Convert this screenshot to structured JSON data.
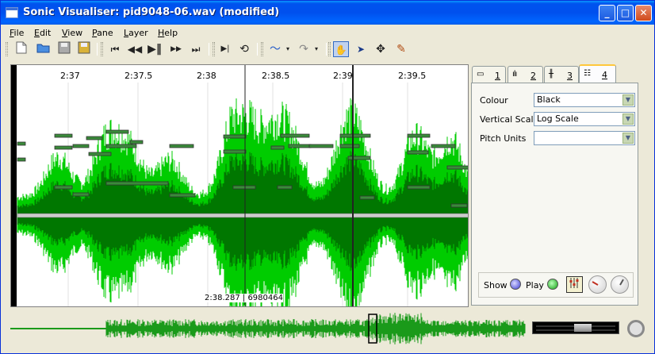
{
  "window": {
    "title": "Sonic Visualiser: pid9048-06.wav (modified)",
    "minimize": "_",
    "maximize": "□",
    "close": "✕"
  },
  "menu": {
    "items": [
      {
        "label": "File",
        "accel": "F",
        "rest": "ile"
      },
      {
        "label": "Edit",
        "accel": "E",
        "rest": "dit"
      },
      {
        "label": "View",
        "accel": "V",
        "rest": "iew"
      },
      {
        "label": "Pane",
        "accel": "P",
        "rest": "ane"
      },
      {
        "label": "Layer",
        "accel": "L",
        "rest": "ayer"
      },
      {
        "label": "Help",
        "accel": "H",
        "rest": "elp"
      }
    ]
  },
  "toolbar": {
    "icons": [
      "new-file-icon",
      "open-folder-icon",
      "save-icon",
      "save-session-icon",
      "rewind-start-icon",
      "rewind-icon",
      "play-pause-icon",
      "fast-forward-icon",
      "forward-end-icon",
      "play-selection-icon",
      "loop-icon",
      "solo-icon",
      "follow-playback-icon",
      "navigate-tool-icon",
      "select-tool-icon",
      "move-tool-icon",
      "draw-tool-icon"
    ],
    "glyphs": {
      "rewind_start": "⏮",
      "rewind": "◀◀",
      "play_pause": "▶‖",
      "ffwd": "▶▶",
      "end": "⏭",
      "play_sel": "▶|",
      "loop": "⟲",
      "solo": "〜",
      "follow": "↷",
      "navigate": "✋",
      "select": "➤",
      "move": "✥",
      "draw": "✎"
    }
  },
  "pane": {
    "time_ticks": [
      "2:37",
      "2:37.5",
      "2:38",
      "2:38.5",
      "2:39",
      "2:39.5"
    ],
    "cursor_readout": "2:38.287 | 6980464",
    "colors": {
      "waveform": "#00cc00",
      "waveform_dark": "#007700",
      "notes": "#333333",
      "note_fill": "#3a8a3a"
    }
  },
  "properties": {
    "tabs": [
      {
        "num": "1",
        "icon": "waveform-layer-icon",
        "glyph": "▭"
      },
      {
        "num": "2",
        "icon": "spectrum-layer-icon",
        "glyph": "ılı"
      },
      {
        "num": "3",
        "icon": "waveform-small-icon",
        "glyph": "╫"
      },
      {
        "num": "4",
        "icon": "notes-layer-icon",
        "glyph": "☷"
      }
    ],
    "selected_tab": "4",
    "fields": [
      {
        "label": "Colour",
        "value": "Black"
      },
      {
        "label": "Vertical Scale",
        "value": "Log Scale"
      },
      {
        "label": "Pitch Units",
        "value": ""
      }
    ],
    "show_label": "Show",
    "play_label": "Play"
  }
}
